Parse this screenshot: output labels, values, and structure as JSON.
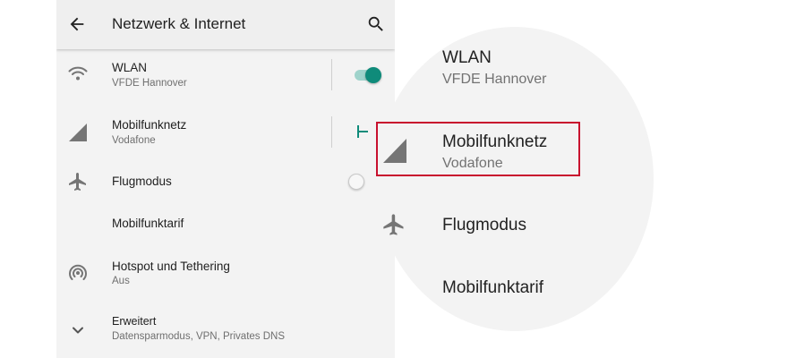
{
  "header": {
    "title": "Netzwerk & Internet",
    "back_icon": "arrow-back-icon",
    "search_icon": "search-icon"
  },
  "settings": [
    {
      "key": "wlan",
      "title": "WLAN",
      "subtitle": "VFDE Hannover",
      "icon": "wifi-icon",
      "toggle": "on"
    },
    {
      "key": "mobile",
      "title": "Mobilfunknetz",
      "subtitle": "Vodafone",
      "icon": "signal-icon"
    },
    {
      "key": "airplane",
      "title": "Flugmodus",
      "icon": "airplane-icon",
      "toggle": "off"
    },
    {
      "key": "tariff",
      "title": "Mobilfunktarif"
    },
    {
      "key": "hotspot",
      "title": "Hotspot und Tethering",
      "subtitle": "Aus",
      "icon": "hotspot-icon"
    },
    {
      "key": "advanced",
      "title": "Erweitert",
      "subtitle": "Datensparmodus, VPN, Privates DNS",
      "icon": "chevron-down-icon"
    }
  ],
  "zoom": {
    "wlan_title": "WLAN",
    "wlan_subtitle": "VFDE Hannover",
    "mobile_title": "Mobilfunknetz",
    "mobile_subtitle": "Vodafone",
    "airplane_title": "Flugmodus",
    "tariff_title": "Mobilfunktarif"
  },
  "colors": {
    "accent": "#0f8b7a",
    "highlight": "#c8102e",
    "icon": "#757575"
  }
}
